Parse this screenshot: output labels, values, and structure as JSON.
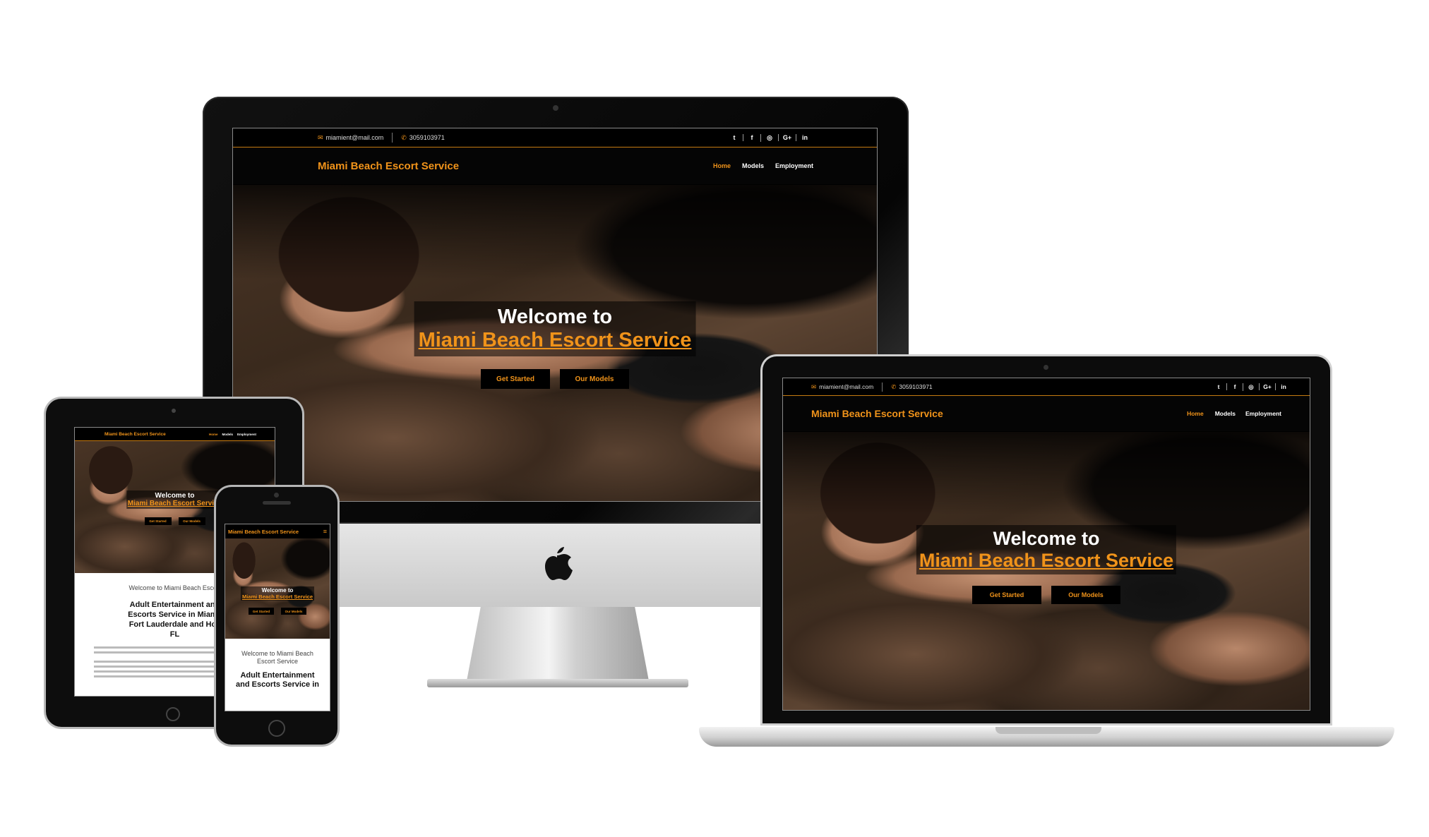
{
  "site": {
    "email": "miamient@mail.com",
    "phone": "3059103971",
    "social": [
      "t",
      "f",
      "◎",
      "G+",
      "in"
    ],
    "brand": "Miami Beach Escort Service",
    "nav": [
      "Home",
      "Models",
      "Employment"
    ],
    "hero_welcome": "Welcome to",
    "hero_brand": "Miami Beach Escort Service",
    "btn_start": "Get Started",
    "btn_models": "Our Models",
    "content_welcome": "Welcome to Miami Beach Escort Service",
    "content_welcome_cut": "Welcome to Miami  Beach  Escort",
    "content_heading": "Adult Entertainment and Escorts Service in Miami, Fort Lauderdale and Hollywood FL",
    "content_heading_tablet": "Adult Entertainment and\nEscorts Service in Miami,\nFort Lauderdale and Holl\nFL",
    "content_heading_phone": "Adult Entertainment\nand Escorts Service in",
    "menu_icon": "hamburger-icon"
  },
  "colors": {
    "accent": "#f0931a",
    "dark": "#000000"
  }
}
